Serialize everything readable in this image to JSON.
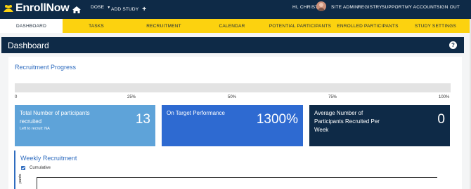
{
  "app": {
    "name": "EnrollNow"
  },
  "topnav": {
    "dose": "DOSE",
    "add_study": "ADD STUDY",
    "greeting": "HI, CHRISTI",
    "site_admin": "SITE ADMIN",
    "registry": "REGISTRY",
    "support": "SUPPORT",
    "my_account": "MY ACCOUNT",
    "sign_out": "SIGN OUT"
  },
  "tabs": [
    {
      "label": "DASHBOARD"
    },
    {
      "label": "TASKS"
    },
    {
      "label": "RECRUITMENT"
    },
    {
      "label": "CALENDAR"
    },
    {
      "label": "POTENTIAL PARTICIPANTS"
    },
    {
      "label": "ENROLLED PARTICIPANTS"
    },
    {
      "label": "STUDY SETTINGS"
    }
  ],
  "dashboard": {
    "title": "Dashboard",
    "help": "?"
  },
  "recruitment_progress": {
    "title": "Recruitment Progress",
    "progress_fraction": 0,
    "ticks": [
      "0",
      "25%",
      "50%",
      "75%",
      "100%"
    ]
  },
  "cards": [
    {
      "label": "Total Number of participants recruited",
      "sub": "Left to recruit: NA",
      "value": "13",
      "color": "#5ea3d9"
    },
    {
      "label": "On Target Performance",
      "value": "1300%",
      "color": "#2e6ad1"
    },
    {
      "label": "Average Number of Participants Recruited Per Week",
      "value": "0",
      "color": "#0e2a47"
    }
  ],
  "weekly": {
    "title": "Weekly Recruitment",
    "cumulative_label": "Cumulative",
    "cumulative_checked": true,
    "y_axis_label": "pants"
  },
  "colors": {
    "navy": "#0e2a47",
    "yellow": "#fcd20f",
    "accent": "#2f6cbf"
  }
}
